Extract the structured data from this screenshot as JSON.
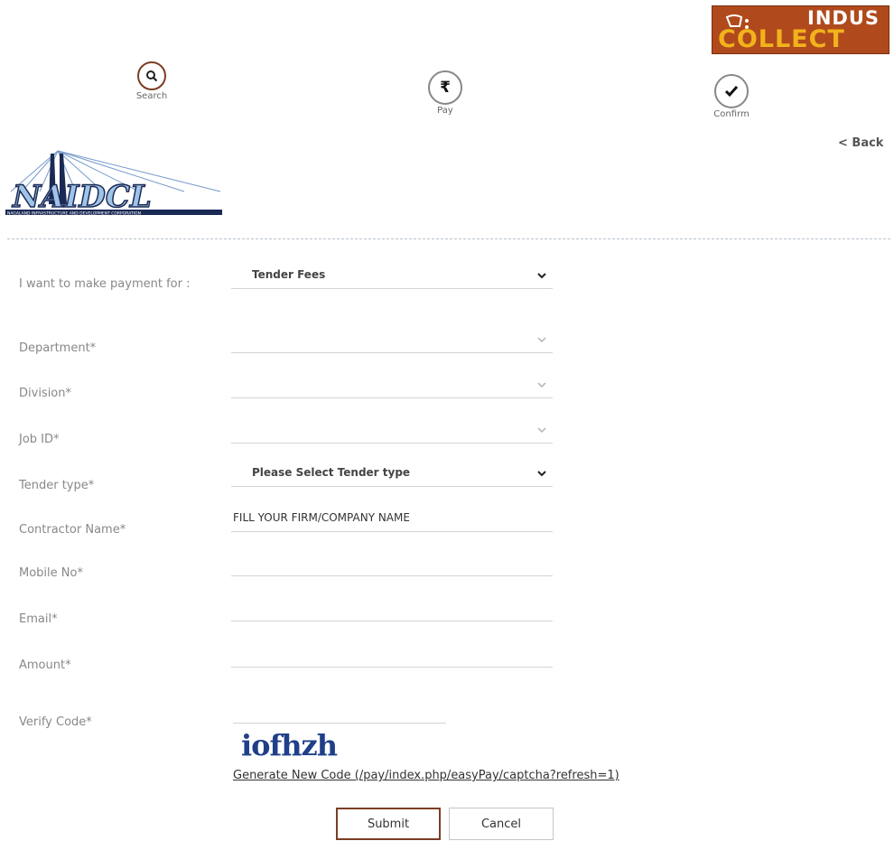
{
  "brand": {
    "line1": "INDUS",
    "line2": "COLLECT"
  },
  "steps": [
    {
      "label": "Search",
      "icon": "search-icon"
    },
    {
      "label": "Pay",
      "icon": "rupee-icon"
    },
    {
      "label": "Confirm",
      "icon": "check-icon"
    }
  ],
  "nav": {
    "back": "< Back"
  },
  "org_logo": {
    "text": "NAIDCL",
    "tagline": "NAGALAND INFRASTRUCTURE AND DEVELOPMENT CORPORATION"
  },
  "form": {
    "payment_for_label": "I want to make payment for :",
    "payment_for_value": "Tender Fees",
    "department_label": "Department*",
    "department_value": "",
    "division_label": "Division*",
    "division_value": "",
    "jobid_label": "Job ID*",
    "jobid_value": "",
    "tender_type_label": "Tender type*",
    "tender_type_value": "Please Select Tender type",
    "contractor_label": "Contractor Name*",
    "contractor_value": "FILL YOUR FIRM/COMPANY NAME",
    "mobile_label": "Mobile No*",
    "mobile_value": "",
    "email_label": "Email*",
    "email_value": "",
    "amount_label": "Amount*",
    "amount_value": "",
    "verify_label": "Verify Code*",
    "verify_value": "",
    "captcha_text": "iofhzh",
    "captcha_link": "Generate New Code (/pay/index.php/easyPay/captcha?refresh=1)"
  },
  "buttons": {
    "submit": "Submit",
    "cancel": "Cancel"
  },
  "colors": {
    "accent": "#7b3d24",
    "brand_bg": "#b04a1c",
    "brand_gold": "#f2b21c",
    "captcha": "#1f3f88"
  }
}
